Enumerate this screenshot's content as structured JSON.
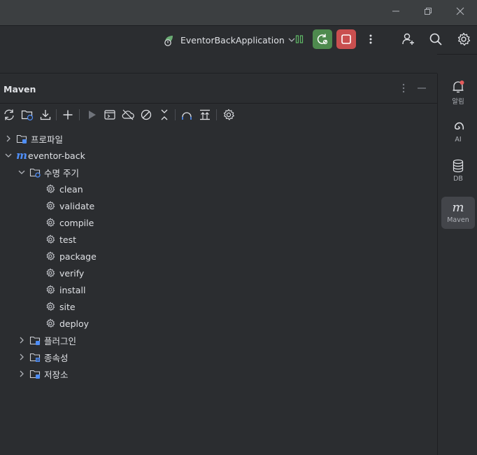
{
  "toolbar": {
    "run_config": "EventorBackApplication",
    "colors": {
      "run_green": "#4e8a4e",
      "stop_red": "#c94f4f",
      "maven_blue": "#4f8ef7"
    }
  },
  "panel": {
    "title": "Maven"
  },
  "tree": {
    "profiles": "프로파일",
    "project": "eventor-back",
    "lifecycle": "수명 주기",
    "phases": [
      "clean",
      "validate",
      "compile",
      "test",
      "package",
      "verify",
      "install",
      "site",
      "deploy"
    ],
    "plugins": "플러그인",
    "dependencies": "종속성",
    "repositories": "저장소"
  },
  "rightbar": {
    "notifications": "알림",
    "ai": "AI",
    "db": "DB",
    "maven": "Maven"
  }
}
